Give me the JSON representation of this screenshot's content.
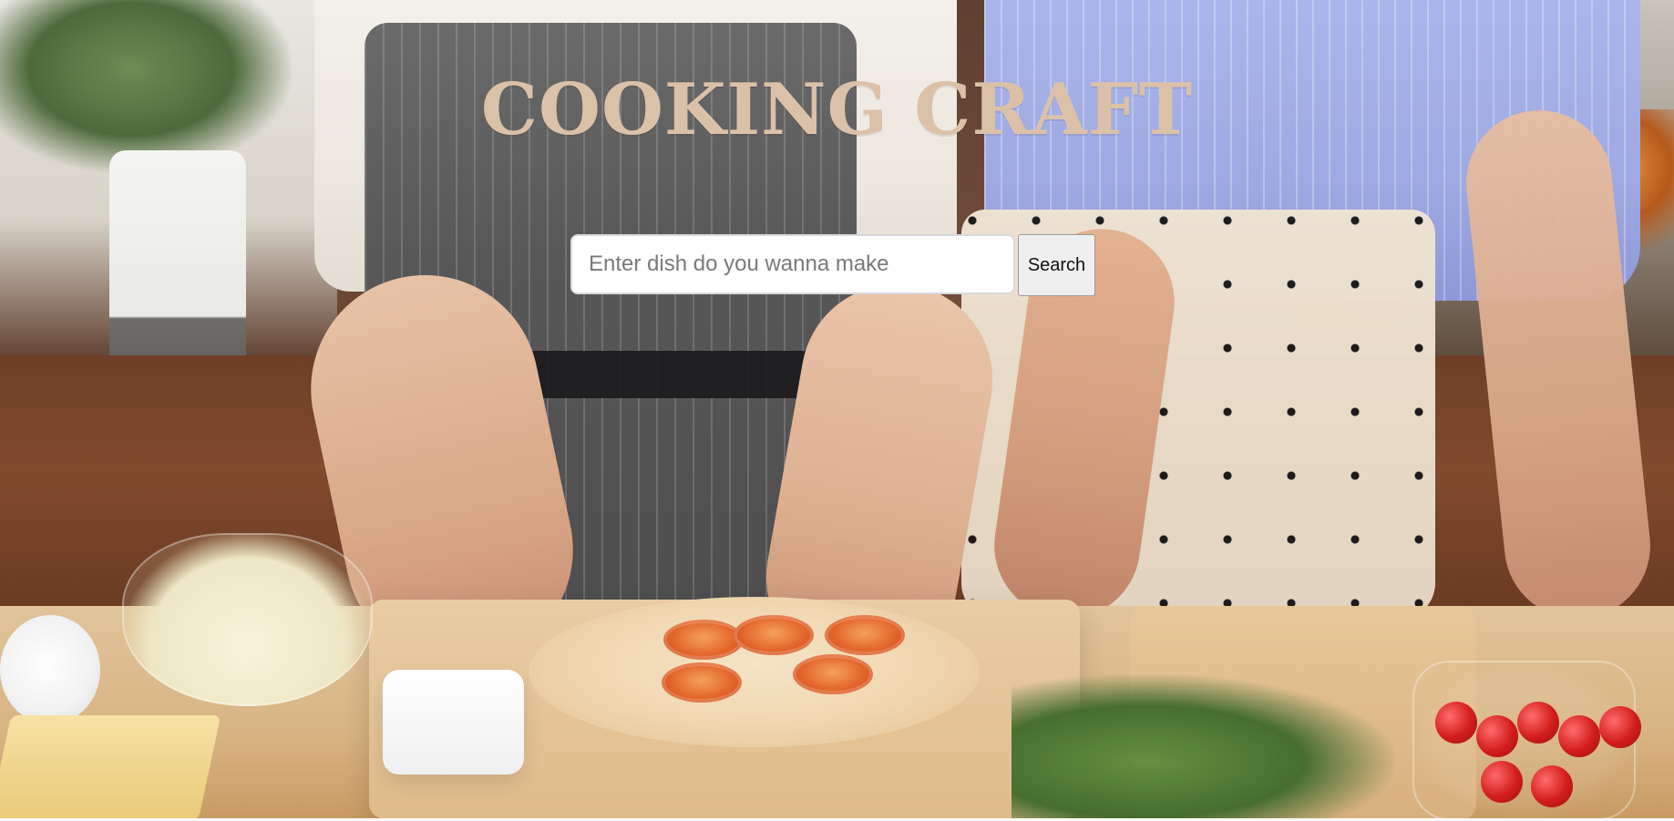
{
  "app": {
    "title": "COOKING CRAFT"
  },
  "search": {
    "placeholder": "Enter dish do you wanna make",
    "value": "",
    "button_label": "Search"
  },
  "colors": {
    "title": "#dcc1a9",
    "input_bg": "#ffffff",
    "input_border": "#d9d9d9",
    "button_bg": "#efefef",
    "button_border": "#9a9a9a"
  }
}
